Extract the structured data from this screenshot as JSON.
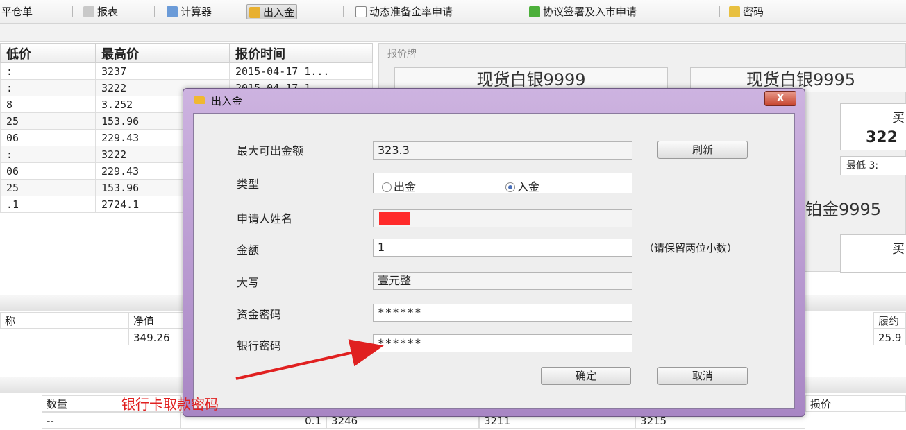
{
  "toolbar": {
    "items": [
      "平仓单",
      "报表",
      "计算器",
      "出入金",
      "动态准备金率申请",
      "协议签署及入市申请",
      "密码"
    ]
  },
  "quote_table": {
    "headers": [
      "低价",
      "最高价",
      "报价时间"
    ],
    "rows": [
      [
        ":",
        "3237",
        "2015-04-17 1..."
      ],
      [
        ":",
        "3222",
        "2015-04-17 1..."
      ],
      [
        "8",
        "3.252",
        ""
      ],
      [
        "25",
        "153.96",
        ""
      ],
      [
        "06",
        "229.43",
        ""
      ],
      [
        ":",
        "3222",
        ""
      ],
      [
        "06",
        "229.43",
        ""
      ],
      [
        "25",
        "153.96",
        ""
      ],
      [
        ".1",
        "2724.1",
        ""
      ]
    ]
  },
  "price_board": {
    "title": "报价牌",
    "card1": "现货白银9999",
    "card2": "现货白银9995",
    "card3": "铂金9995",
    "value1": "322",
    "low_label": "最低 3:",
    "side_char": "买"
  },
  "mid_panel": {
    "left_label": "称",
    "net_value_label": "净值",
    "net_value": "349.26",
    "right_label": "履约",
    "right_value": "25.9"
  },
  "bottom_panel": {
    "qty_label": "数量",
    "qty_value": "--",
    "loss_label": "损价",
    "values": [
      "0.1",
      "3246",
      "3211",
      "3215"
    ]
  },
  "dialog": {
    "title": "出入金",
    "close_label": "X",
    "max_amount_label": "最大可出金额",
    "max_amount_value": "323.3",
    "refresh_label": "刷新",
    "type_label": "类型",
    "type_options": [
      "出金",
      "入金"
    ],
    "type_selected": "入金",
    "applicant_label": "申请人姓名",
    "amount_label": "金额",
    "amount_value": "1",
    "amount_hint": "（请保留两位小数）",
    "uppercase_label": "大写",
    "uppercase_value": "壹元整",
    "fund_password_label": "资金密码",
    "fund_password_value": "******",
    "bank_password_label": "银行密码",
    "bank_password_value": "******",
    "confirm_label": "确定",
    "cancel_label": "取消"
  },
  "annotation": {
    "text": "银行卡取款密码",
    "color": "#e02020"
  }
}
